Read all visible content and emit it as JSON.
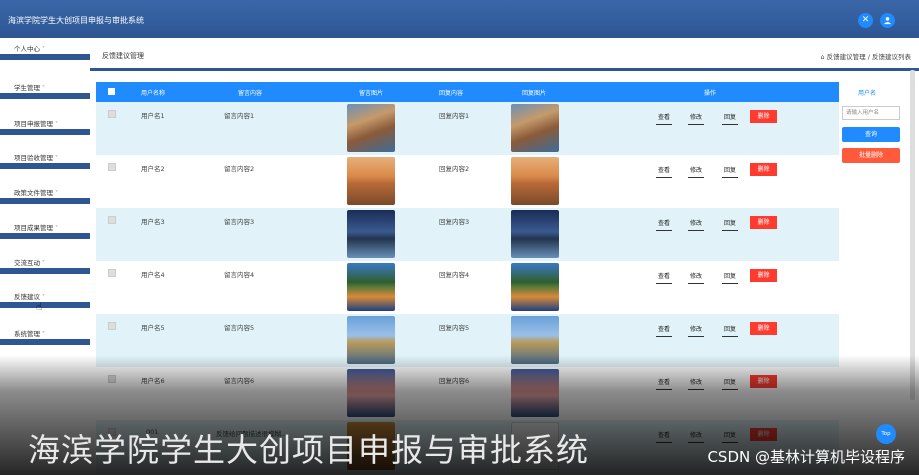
{
  "app": {
    "title": "海滨学院学生大创项目申报与审批系统"
  },
  "header_icons": [
    "settings-icon",
    "user-icon"
  ],
  "sidebar": {
    "items": [
      {
        "label": "个人中心"
      },
      {
        "label": "学生管理"
      },
      {
        "label": "项目申报管理"
      },
      {
        "label": "项目验收管理"
      },
      {
        "label": "政策文件管理"
      },
      {
        "label": "项目成果管理"
      },
      {
        "label": "交流互动"
      },
      {
        "label": "反馈建议"
      },
      {
        "label": "系统管理"
      }
    ]
  },
  "page": {
    "title": "反馈建议管理",
    "breadcrumb": "反馈建议管理 / 反馈建议列表"
  },
  "table": {
    "columns": [
      "用户名称",
      "留言内容",
      "留言图片",
      "回复内容",
      "回复图片",
      "操作"
    ],
    "rows": [
      {
        "user": "用户名1",
        "content": "留言内容1",
        "reply": "回复内容1"
      },
      {
        "user": "用户名2",
        "content": "留言内容2",
        "reply": "回复内容2"
      },
      {
        "user": "用户名3",
        "content": "留言内容3",
        "reply": "回复内容3"
      },
      {
        "user": "用户名4",
        "content": "留言内容4",
        "reply": "回复内容4"
      },
      {
        "user": "用户名5",
        "content": "留言内容5",
        "reply": "回复内容5"
      },
      {
        "user": "用户名6",
        "content": "留言内容6",
        "reply": "回复内容6"
      },
      {
        "user": "001",
        "content": "反馈给问题描述很模糊...",
        "reply": ""
      }
    ],
    "actions": {
      "view": "查看",
      "edit": "修改",
      "reply": "回复",
      "delete": "删除"
    }
  },
  "search": {
    "label": "用户名",
    "placeholder": "请输入用户名",
    "search_button": "查询",
    "batch_delete_button": "批量删除"
  },
  "overlay": {
    "caption": "海滨学院学生大创项目申报与审批系统",
    "watermark": "CSDN @基林计算机毕设程序",
    "top_button": "Top"
  },
  "colors": {
    "header_bg": "#2d5693",
    "accent": "#1f8bff",
    "danger": "#ff3b30",
    "row_alt": "#e1f3f8"
  }
}
